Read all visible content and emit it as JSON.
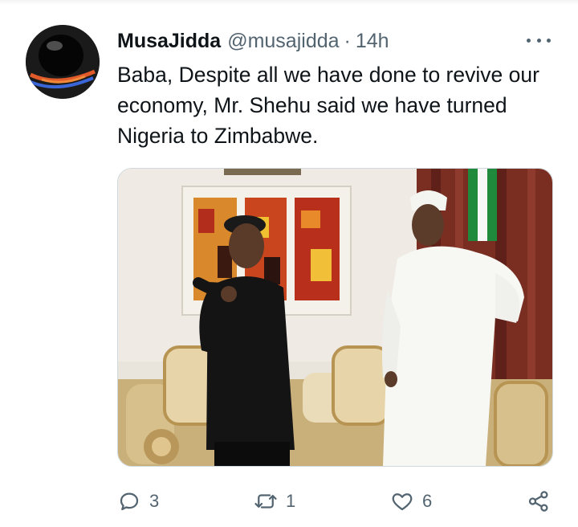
{
  "tweet": {
    "author_name": "MusaJidda",
    "handle": "@musajidda",
    "separator": "·",
    "time": "14h",
    "text": "Baba, Despite all we have done to revive our economy, Mr. Shehu said we have turned Nigeria to Zimbabwe."
  },
  "media": {
    "kind": "photo",
    "alt_visible": false
  },
  "actions": {
    "reply_count": "3",
    "retweet_count": "1",
    "like_count": "6"
  },
  "icons": {
    "more": "more-horizontal-icon",
    "reply": "reply-icon",
    "retweet": "retweet-icon",
    "like": "heart-icon",
    "share": "share-icon"
  },
  "colors": {
    "text_primary": "#0f1419",
    "text_secondary": "#536471",
    "border": "#cfd9de"
  }
}
